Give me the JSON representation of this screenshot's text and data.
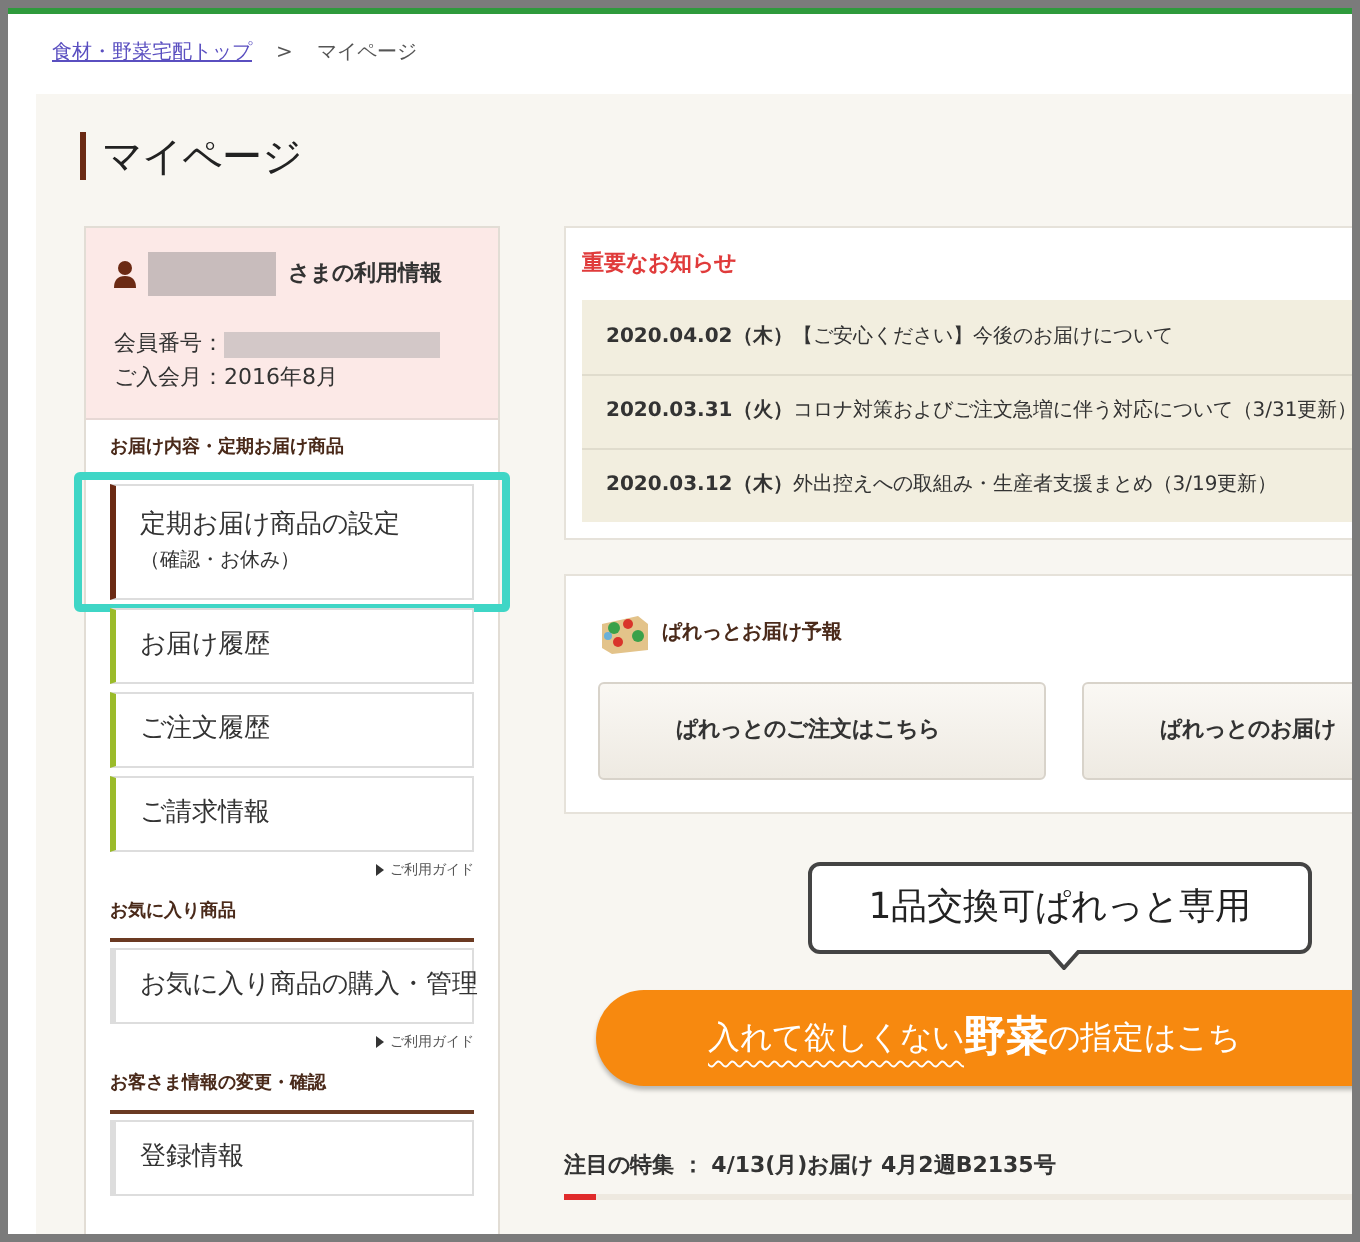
{
  "breadcrumb": [
    {
      "label": "食材・野菜宅配トップ",
      "link": true
    },
    {
      "label": ">",
      "link": false
    },
    {
      "label": "マイページ",
      "link": false
    }
  ],
  "title": "マイページ",
  "member": {
    "suffix": "さまの利用情報",
    "number_label": "会員番号：",
    "joined": "ご入会月：2016年8月"
  },
  "sections": [
    {
      "heading": "お届け内容・定期お届け商品",
      "guide": "ご利用ガイド",
      "items": [
        {
          "label": "定期お届け商品の設定",
          "sub": "（確認・お休み）",
          "selected": true,
          "highlighted": true
        },
        {
          "label": "お届け履歴",
          "selected": false,
          "highlighted": false
        },
        {
          "label": "ご注文履歴",
          "selected": false,
          "highlighted": false
        },
        {
          "label": "ご請求情報",
          "selected": false,
          "highlighted": false
        }
      ]
    },
    {
      "heading": "お気に入り商品",
      "guide": "ご利用ガイド",
      "items": [
        {
          "label": "お気に入り商品の購入・管理",
          "selected": false,
          "highlighted": false
        }
      ]
    },
    {
      "heading": "お客さま情報の変更・確認",
      "items": [
        {
          "label": "登録情報",
          "selected": false,
          "highlighted": false
        }
      ]
    }
  ],
  "notices": {
    "heading": "重要なお知らせ",
    "items": [
      {
        "date": "2020.04.02（木）",
        "text": "【ご安心ください】今後のお届けについて"
      },
      {
        "date": "2020.03.31（火）",
        "text": "コロナ対策およびご注文急増に伴う対応について（3/31更新）"
      },
      {
        "date": "2020.03.12（木）",
        "text": "外出控えへの取組み・生産者支援まとめ（3/19更新）"
      }
    ]
  },
  "forecast": {
    "heading": "ぱれっとお届け予報",
    "buttons": [
      "ぱれっとのご注文はこちら",
      "ぱれっとのお届け"
    ]
  },
  "callout": "1品交換可ぱれっと専用",
  "banner": {
    "parts": [
      {
        "kind": "underlined",
        "text": "入れて欲しくない"
      },
      {
        "kind": "large",
        "text": "野菜"
      },
      {
        "kind": "plain",
        "text": "の指定はこち"
      }
    ]
  },
  "feature": "注目の特集 ： 4/13(月)お届け 4月2週B2135号"
}
